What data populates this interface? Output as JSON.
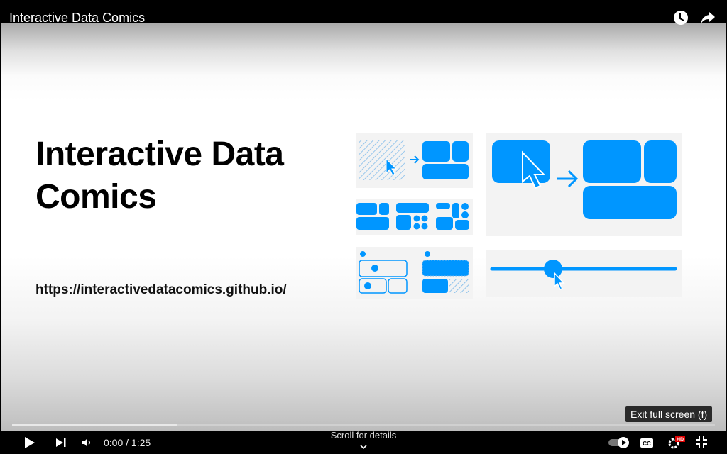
{
  "header": {
    "video_title": "Interactive Data Comics",
    "icons": [
      "watch-later-icon",
      "share-icon"
    ]
  },
  "slide": {
    "title_line1": "Interactive Data",
    "title_line2": "Comics",
    "url": "https://interactivedatacomics.github.io/",
    "accent_color": "#0096ff"
  },
  "player": {
    "time_current": "0:00",
    "time_total": "1:25",
    "time_display": "0:00 / 1:25",
    "scroll_hint": "Scroll for details",
    "tooltip": "Exit full screen (f)",
    "progress_played_fraction": 0.0,
    "buffered_fraction": 0.235,
    "autoplay": "on",
    "quality_badge": "HD",
    "quality_badge_color": "#e00000"
  },
  "controls": [
    "play-icon",
    "next-icon",
    "volume-icon",
    "autoplay-toggle",
    "captions-icon",
    "settings-icon",
    "exit-fullscreen-icon"
  ]
}
